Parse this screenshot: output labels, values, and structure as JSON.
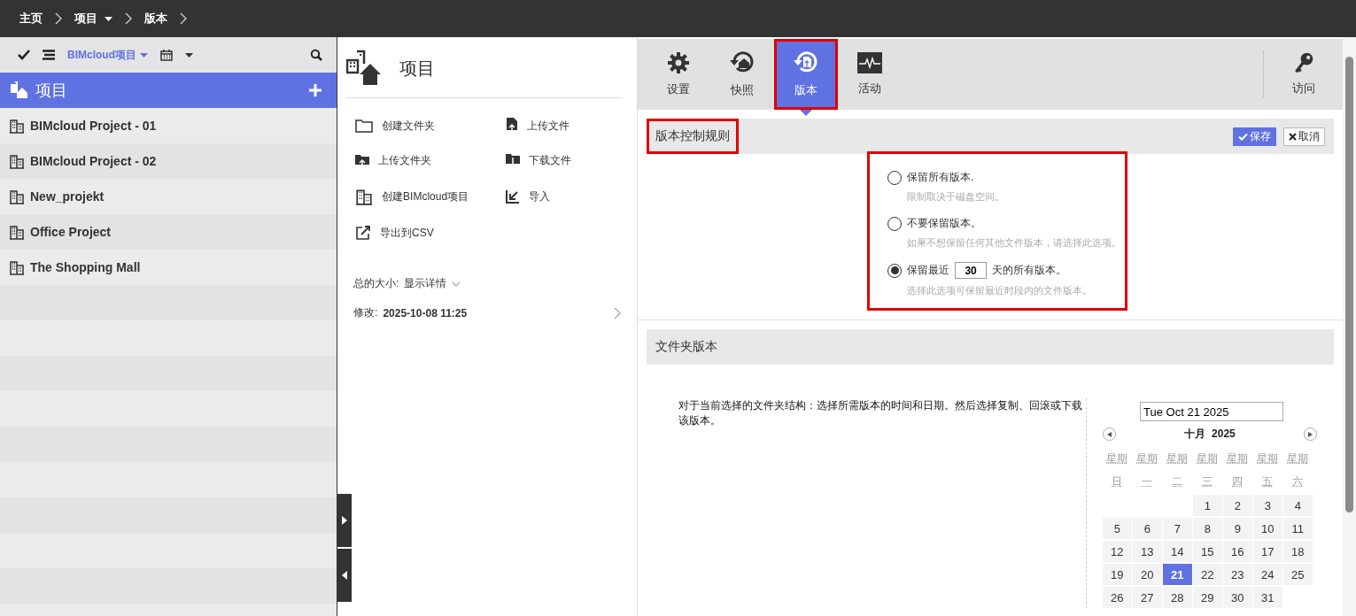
{
  "breadcrumb": [
    {
      "label": "主页",
      "has_menu": false
    },
    {
      "label": "项目",
      "has_menu": true
    },
    {
      "label": "版本",
      "has_menu": false
    }
  ],
  "sidebar": {
    "filter": "BIMcloud项目",
    "header": "项目",
    "projects": [
      {
        "name": "BIMcloud Project - 01"
      },
      {
        "name": "BIMcloud Project - 02"
      },
      {
        "name": "New_projekt"
      },
      {
        "name": "Office Project"
      },
      {
        "name": "The Shopping Mall"
      }
    ]
  },
  "details": {
    "title": "项目",
    "actions": [
      {
        "label": "创建文件夹"
      },
      {
        "label": "上传文件"
      },
      {
        "label": "上传文件夹"
      },
      {
        "label": "下载文件"
      },
      {
        "label": "创建BIMcloud项目"
      },
      {
        "label": "导入"
      },
      {
        "label": "导出到CSV"
      }
    ],
    "size_label": "总的大小:",
    "size_link": "显示详情",
    "modified_label": "修改:",
    "modified_value": "2025-10-08 11:25"
  },
  "tabs": [
    {
      "label": "设置",
      "selected": false,
      "annotated": false
    },
    {
      "label": "快照",
      "selected": false,
      "annotated": false
    },
    {
      "label": "版本",
      "selected": true,
      "annotated": true
    },
    {
      "label": "活动",
      "selected": false,
      "annotated": false
    }
  ],
  "access_tab": {
    "label": "访问"
  },
  "rules": {
    "title": "版本控制规则",
    "title_annotated": true,
    "save": "保存",
    "cancel": "取消",
    "options_annotated": true,
    "options": [
      {
        "kind": "plain",
        "label": "保留所有版本.",
        "hint": "限制取决于磁盘空间。",
        "selected": false
      },
      {
        "kind": "plain",
        "label": "不要保留版本。",
        "hint": "如果不想保留任何其他文件版本，请选择此选项。",
        "selected": false
      },
      {
        "kind": "days",
        "label": "保留最近",
        "days": "30",
        "suffix": "天的所有版本。",
        "hint": "选择此选项可保留最近时段内的文件版本。",
        "selected": true
      }
    ]
  },
  "folder_versions": {
    "title": "文件夹版本",
    "description": "对于当前选择的文件夹结构：选择所需版本的时间和日期。然后选择复制、回滚或下载该版本。",
    "date_value": "Tue Oct 21 2025",
    "calendar": {
      "month": "十月",
      "year": "2025",
      "weekdays": [
        "星期日",
        "星期一",
        "星期二",
        "星期三",
        "星期四",
        "星期五",
        "星期六"
      ],
      "weeks": [
        [
          {
            "d": "1",
            "selected": false
          },
          {
            "d": "2",
            "selected": false
          },
          {
            "d": "3",
            "selected": false
          },
          {
            "d": "4",
            "selected": false
          }
        ],
        [
          {
            "d": "5",
            "selected": false
          },
          {
            "d": "6",
            "selected": false
          },
          {
            "d": "7",
            "selected": false
          },
          {
            "d": "8",
            "selected": false
          },
          {
            "d": "9",
            "selected": false
          },
          {
            "d": "10",
            "selected": false
          },
          {
            "d": "11",
            "selected": false
          }
        ],
        [
          {
            "d": "12",
            "selected": false
          },
          {
            "d": "13",
            "selected": false
          },
          {
            "d": "14",
            "selected": false
          },
          {
            "d": "15",
            "selected": false
          },
          {
            "d": "16",
            "selected": false
          },
          {
            "d": "17",
            "selected": false
          },
          {
            "d": "18",
            "selected": false
          }
        ],
        [
          {
            "d": "19",
            "selected": false
          },
          {
            "d": "20",
            "selected": false
          },
          {
            "d": "21",
            "selected": true
          },
          {
            "d": "22",
            "selected": false
          },
          {
            "d": "23",
            "selected": false
          },
          {
            "d": "24",
            "selected": false
          },
          {
            "d": "25",
            "selected": false
          }
        ],
        [
          {
            "d": "26",
            "selected": false
          },
          {
            "d": "27",
            "selected": false
          },
          {
            "d": "28",
            "selected": false
          },
          {
            "d": "29",
            "selected": false
          },
          {
            "d": "30",
            "selected": false
          },
          {
            "d": "31",
            "selected": false
          }
        ]
      ]
    }
  }
}
